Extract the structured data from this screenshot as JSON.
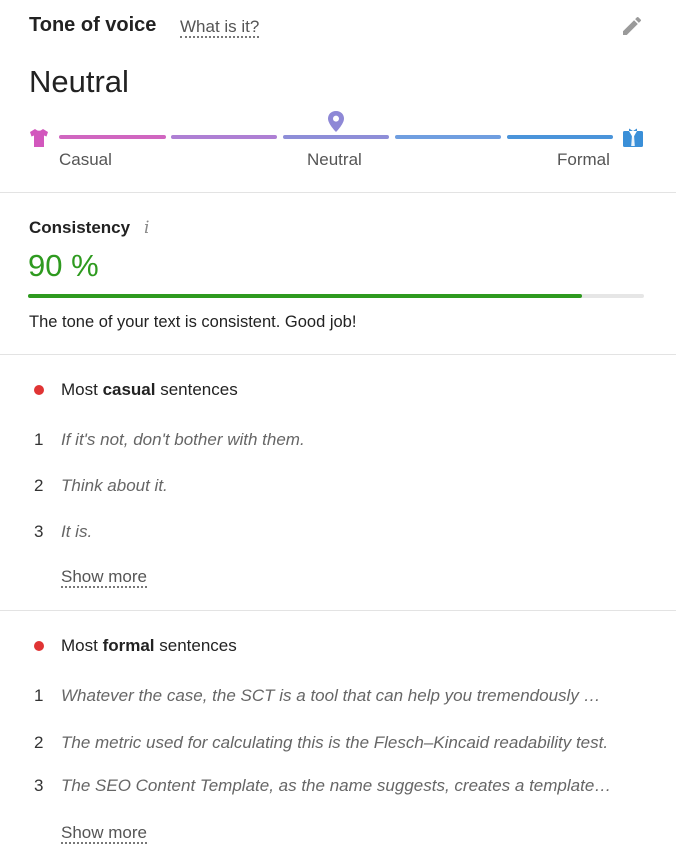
{
  "header": {
    "title": "Tone of voice",
    "what_is_it": "What is it?"
  },
  "tone": {
    "value": "Neutral",
    "scale_labels": {
      "left": "Casual",
      "middle": "Neutral",
      "right": "Formal"
    },
    "marker_position": "Neutral",
    "segment_colors": [
      "#d066c0",
      "#ae7fd4",
      "#8e8ed8",
      "#6f9ee0",
      "#4a94da"
    ]
  },
  "consistency": {
    "title": "Consistency",
    "percent_text": "90 %",
    "percent_value": 90,
    "message": "The tone of your text is consistent. Good job!",
    "color": "#2e9a1f"
  },
  "casual": {
    "prefix": "Most ",
    "emph": "casual",
    "suffix": " sentences",
    "dot_color": "#e03434",
    "items": [
      {
        "num": "1",
        "text": "If it's not, don't bother with them."
      },
      {
        "num": "2",
        "text": "Think about it."
      },
      {
        "num": "3",
        "text": "It is."
      }
    ],
    "show_more": "Show more"
  },
  "formal": {
    "prefix": "Most ",
    "emph": "formal",
    "suffix": " sentences",
    "dot_color": "#e03434",
    "items": [
      {
        "num": "1",
        "text": "Whatever the case, the SCT is a tool that can help you tremendously …"
      },
      {
        "num": "2",
        "text": "The metric used for calculating this is the Flesch–Kincaid readability test."
      },
      {
        "num": "3",
        "text": "The SEO Content Template, as the name suggests, creates a template…"
      }
    ],
    "show_more": "Show more"
  },
  "icons": {
    "edit": "pencil-icon",
    "casual": "tshirt-icon",
    "formal": "suit-icon",
    "marker": "location-pin-icon",
    "info": "info-icon",
    "bullet": "dot-icon"
  }
}
